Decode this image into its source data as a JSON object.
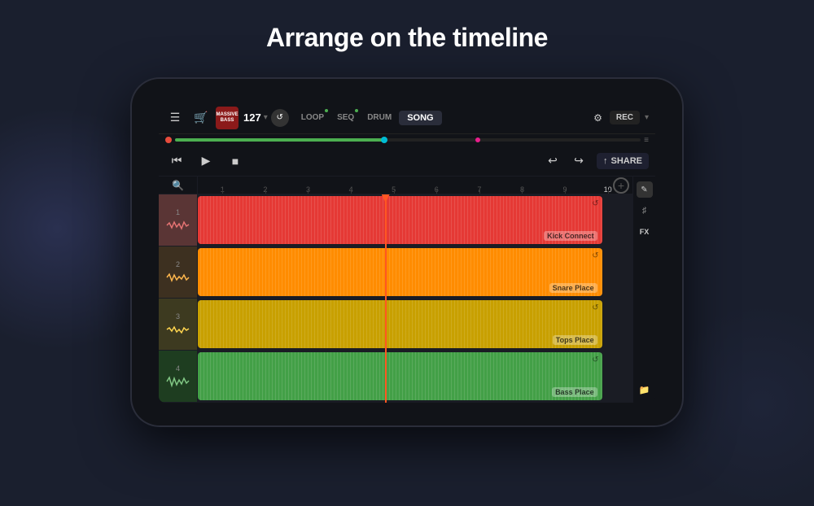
{
  "headline": "Arrange on the timeline",
  "topbar": {
    "bpm": "127",
    "bpm_arrow": "▾",
    "loop_label": "LOOP",
    "seq_label": "SEQ",
    "drum_label": "DRUM",
    "song_label": "SONG",
    "rec_label": "REC",
    "mixer_icon": "⚙",
    "menu_icon": "☰",
    "cart_icon": "🛒"
  },
  "controls": {
    "rewind_icon": "⏮",
    "play_icon": "▶",
    "stop_icon": "■",
    "undo_icon": "↩",
    "redo_icon": "↪",
    "share_label": "SHARE"
  },
  "ruler": {
    "marks": [
      "1",
      "2",
      "3",
      "4",
      "5",
      "6",
      "7",
      "8",
      "9",
      "10"
    ]
  },
  "tracks": [
    {
      "num": "1",
      "color_class": "tl-1",
      "clip_start": "0%",
      "clip_width": "95%",
      "clip_label": "Kick Connect",
      "row_class": "track-row-1"
    },
    {
      "num": "2",
      "color_class": "tl-2",
      "clip_start": "0%",
      "clip_width": "95%",
      "clip_label": "Snare Place",
      "row_class": "track-row-2"
    },
    {
      "num": "3",
      "color_class": "tl-3",
      "clip_start": "0%",
      "clip_width": "95%",
      "clip_label": "Tops Place",
      "row_class": "track-row-3"
    },
    {
      "num": "4",
      "color_class": "tl-4",
      "clip_start": "0%",
      "clip_width": "95%",
      "clip_label": "Bass Place",
      "row_class": "track-row-4"
    }
  ],
  "right_panel": {
    "expand_icon": "✎",
    "tune_icon": "♯",
    "fx_label": "FX",
    "folder_icon": "📁"
  }
}
